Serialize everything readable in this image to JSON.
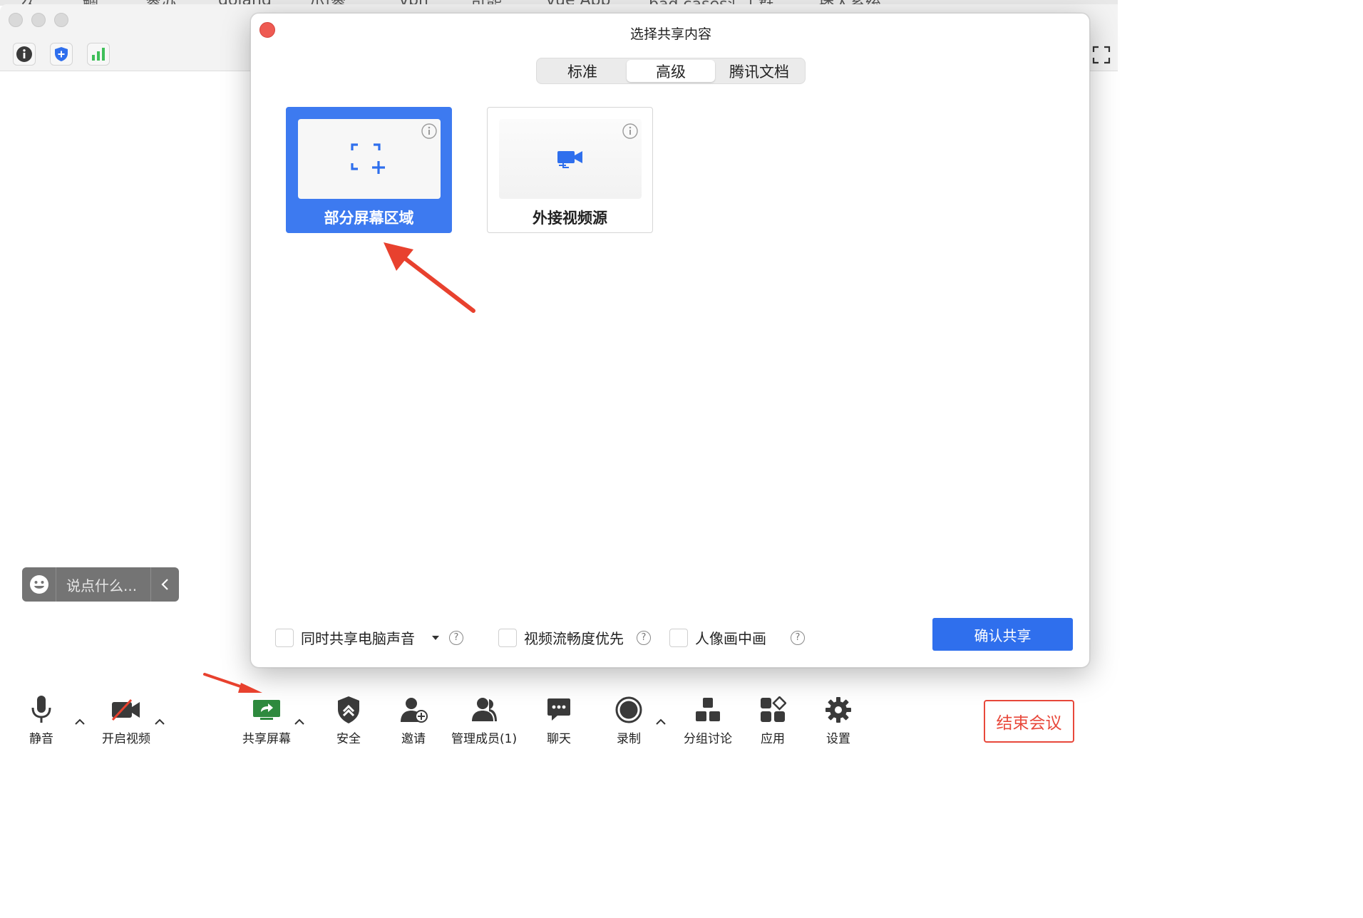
{
  "background_tabs": [
    "久",
    "鲷",
    "睿办",
    "goland",
    "小|睿",
    "vpn",
    "可能",
    "vue App",
    "bad cases汇 | 群...",
    "播入系统"
  ],
  "top_toolbar": {
    "icons": [
      "info-icon",
      "shield-icon",
      "signal-icon"
    ],
    "fullscreen_icon": "fullscreen-icon"
  },
  "chat": {
    "placeholder": "说点什么..."
  },
  "dialog": {
    "title": "选择共享内容",
    "tabs": [
      {
        "label": "标准",
        "active": false
      },
      {
        "label": "高级",
        "active": true
      },
      {
        "label": "腾讯文档",
        "active": false
      }
    ],
    "cards": [
      {
        "label": "部分屏幕区域",
        "selected": true,
        "icon": "region-select-icon"
      },
      {
        "label": "外接视频源",
        "selected": false,
        "icon": "video-source-icon"
      }
    ],
    "options": [
      {
        "label": "同时共享电脑声音",
        "checked": false
      },
      {
        "label": "视频流畅度优先",
        "checked": false
      },
      {
        "label": "人像画中画",
        "checked": false
      }
    ],
    "help_glyph": "?",
    "confirm_label": "确认共享"
  },
  "controls": {
    "items": [
      {
        "label": "静音",
        "icon": "microphone-icon"
      },
      {
        "label": "开启视频",
        "icon": "video-off-icon"
      },
      {
        "label": "共享屏幕",
        "icon": "share-screen-icon"
      },
      {
        "label": "安全",
        "icon": "security-icon"
      },
      {
        "label": "邀请",
        "icon": "invite-icon"
      },
      {
        "label": "管理成员(1)",
        "icon": "members-icon"
      },
      {
        "label": "聊天",
        "icon": "chat-icon"
      },
      {
        "label": "录制",
        "icon": "record-icon"
      },
      {
        "label": "分组讨论",
        "icon": "breakout-icon"
      },
      {
        "label": "应用",
        "icon": "apps-icon"
      },
      {
        "label": "设置",
        "icon": "settings-icon"
      }
    ],
    "end_label": "结束会议"
  },
  "colors": {
    "accent_blue": "#2f6fed",
    "selected_card": "#3d7af0",
    "end_red": "#e8483b",
    "annotation_red": "#e8412e"
  }
}
